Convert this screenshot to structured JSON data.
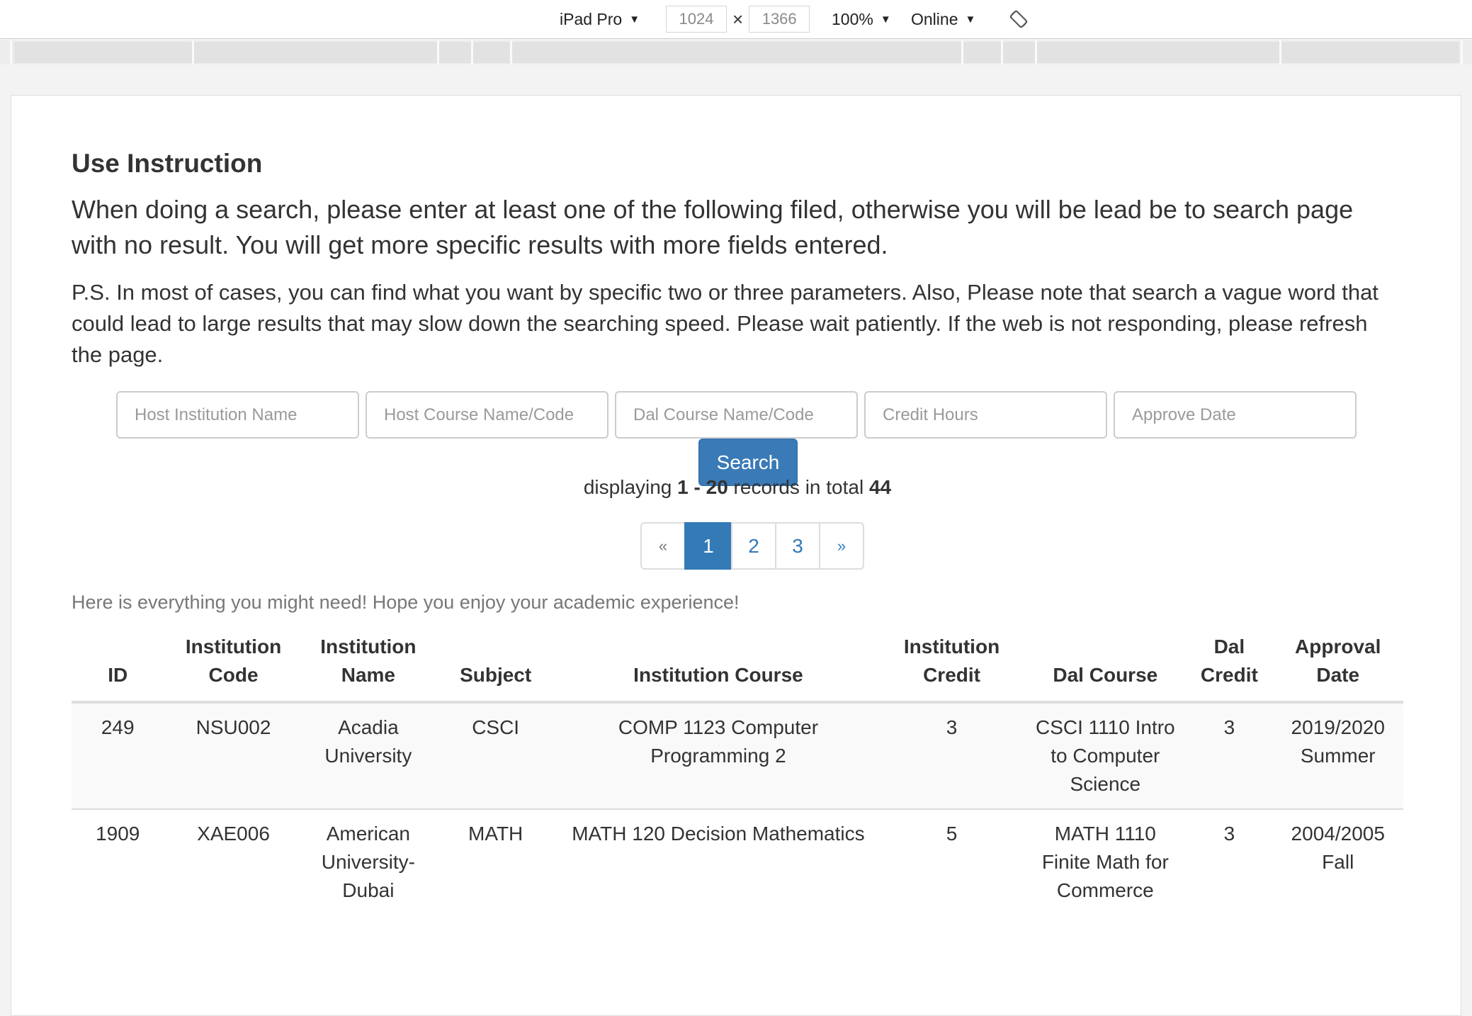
{
  "toolbar": {
    "device": "iPad Pro",
    "width": "1024",
    "height": "1366",
    "times": "×",
    "zoom": "100%",
    "network": "Online",
    "caret": "▼"
  },
  "instructions": {
    "title": "Use Instruction",
    "lead": "When doing a search, please enter at least one of the following filed, otherwise you will be lead be to search page with no result. You will get more specific results with more fields entered.",
    "ps": "P.S. In most of cases, you can find what you want by specific two or three parameters. Also, Please note that search a vague word that could lead to large results that may slow down the searching speed. Please wait patiently. If the web is not responding, please refresh the page."
  },
  "search": {
    "host_institution_placeholder": "Host Institution Name",
    "host_course_placeholder": "Host Course Name/Code",
    "dal_course_placeholder": "Dal Course Name/Code",
    "credit_hours_placeholder": "Credit Hours",
    "approve_date_placeholder": "Approve Date",
    "button_label": "Search"
  },
  "records": {
    "prefix": "displaying ",
    "range": "1 - 20",
    "middle": " records in total ",
    "total": "44"
  },
  "pagination": {
    "prev": "«",
    "pages": [
      "1",
      "2",
      "3"
    ],
    "active": "1",
    "next": "»"
  },
  "note": "Here is everything you might need! Hope you enjoy your academic experience!",
  "table": {
    "headers": [
      "ID",
      "Institution Code",
      "Institution Name",
      "Subject",
      "Institution Course",
      "Institution Credit",
      "Dal Course",
      "Dal Credit",
      "Approval Date"
    ],
    "rows": [
      [
        "249",
        "NSU002",
        "Acadia University",
        "CSCI",
        "COMP 1123 Computer Programming 2",
        "3",
        "CSCI 1110 Intro to Computer Science",
        "3",
        "2019/2020 Summer"
      ],
      [
        "1909",
        "XAE006",
        "American University-Dubai",
        "MATH",
        "MATH 120 Decision Mathematics",
        "5",
        "MATH 1110 Finite Math for Commerce",
        "3",
        "2004/2005 Fall"
      ]
    ]
  }
}
